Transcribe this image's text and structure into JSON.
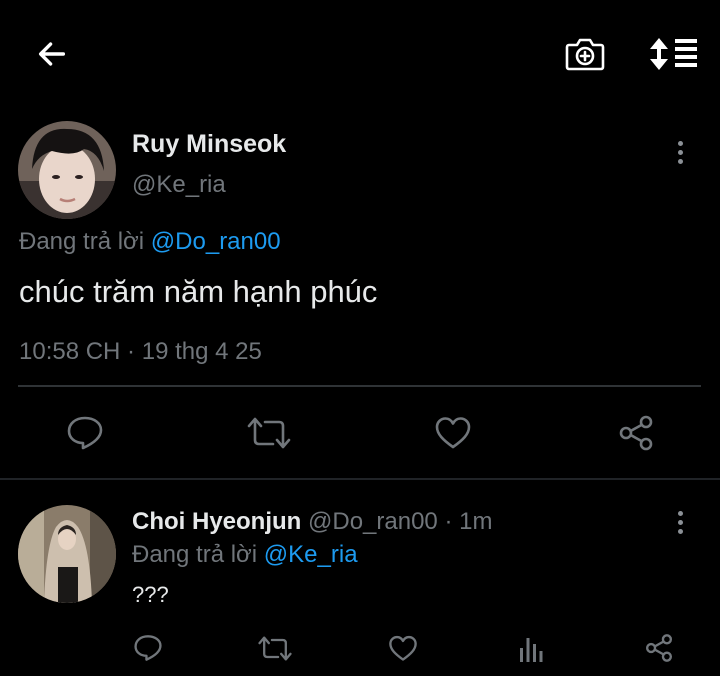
{
  "colors": {
    "background": "#000000",
    "text": "#e7e9ea",
    "muted": "#71767b",
    "link": "#1d9bf0",
    "divider": "#2f3336"
  },
  "header": {
    "back_icon": "arrow-left-icon",
    "camera_icon": "add-photo-camera-icon",
    "sort_icon": "sort-replies-icon"
  },
  "main_tweet": {
    "display_name": "Ruy Minseok",
    "handle": "@Ke_ria",
    "replying_prefix": "Đang trả lời",
    "replying_to": "@Do_ran00",
    "text": "chúc trăm năm hạnh phúc",
    "timestamp": "10:58 CH · 19 thg 4 25",
    "actions": [
      "reply-icon",
      "retweet-icon",
      "like-icon",
      "share-icon"
    ]
  },
  "reply": {
    "display_name": "Choi Hyeonjun",
    "handle_time": "@Do_ran00 · 1m",
    "replying_prefix": "Đang trả lời",
    "replying_to": "@Ke_ria",
    "text": "???",
    "actions": [
      "reply-icon",
      "retweet-icon",
      "like-icon",
      "analytics-icon",
      "share-icon"
    ]
  }
}
